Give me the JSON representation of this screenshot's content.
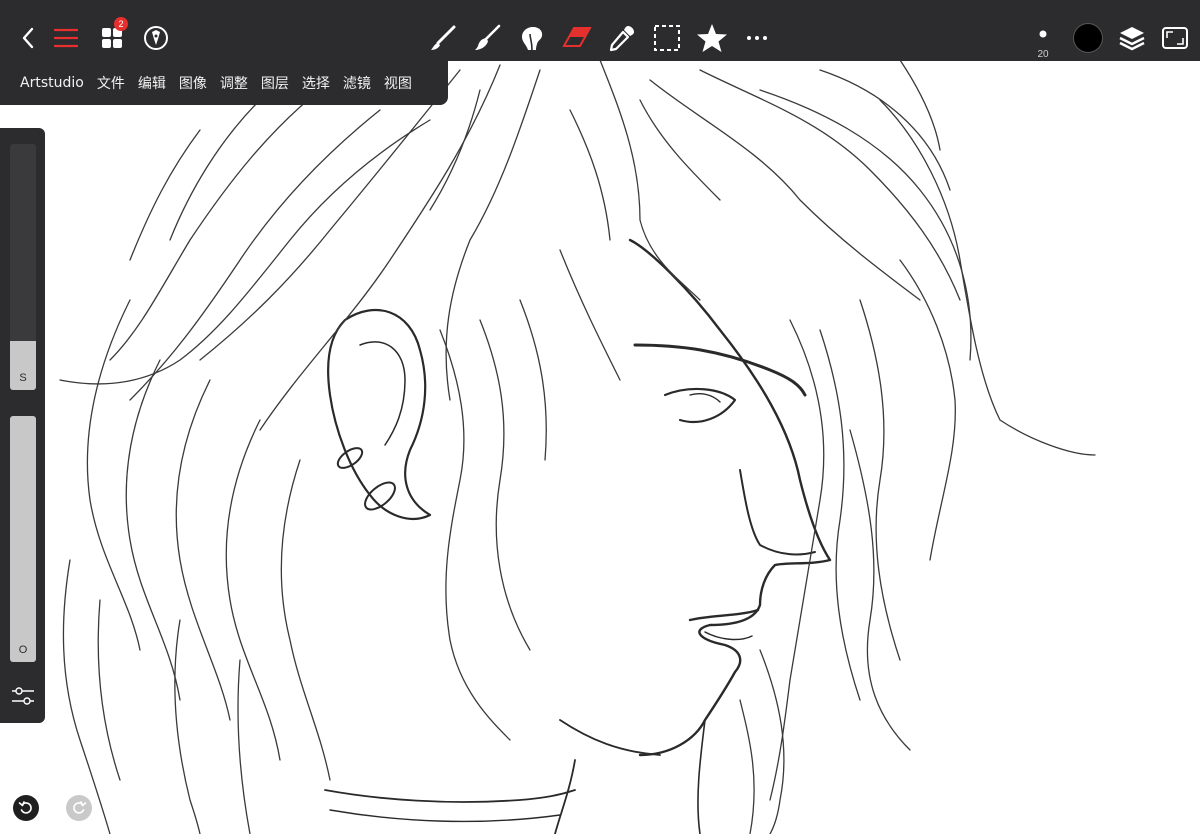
{
  "app": {
    "name": "Artstudio"
  },
  "toolbar": {
    "left": [
      {
        "name": "back-icon"
      },
      {
        "name": "menu-icon"
      },
      {
        "name": "gallery-icon",
        "badge": "2"
      },
      {
        "name": "pen-tip-icon"
      }
    ],
    "tools": [
      "brush-tool-icon",
      "paint-brush-tool-icon",
      "smudge-tool-icon",
      "eraser-tool-icon",
      "eyedropper-tool-icon",
      "selection-tool-icon",
      "favorites-star-icon",
      "more-icon"
    ],
    "active_tool": "eraser-tool-icon",
    "brush_size": "20",
    "current_color": "#000000",
    "right": [
      "brush-size-icon",
      "color-swatch",
      "layers-icon",
      "fullscreen-icon"
    ]
  },
  "menu": {
    "items": [
      "Artstudio",
      "文件",
      "编辑",
      "图像",
      "调整",
      "图层",
      "选择",
      "滤镜",
      "视图"
    ]
  },
  "sidebar": {
    "size_slider": {
      "label": "S",
      "fill": 0.2
    },
    "opacity_slider": {
      "label": "O",
      "fill": 1.0
    }
  },
  "history": {
    "undo": "undo-icon",
    "redo": "redo-icon",
    "redo_enabled": false
  },
  "colors": {
    "toolbar_bg": "#2c2c2e",
    "accent": "#e5302d",
    "canvas": "#ffffff"
  }
}
